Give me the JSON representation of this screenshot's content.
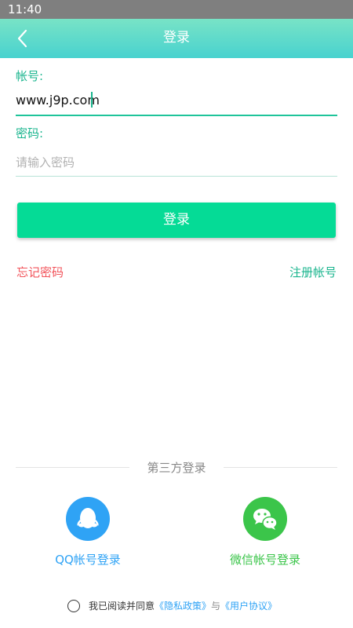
{
  "status_bar": {
    "time": "11:40"
  },
  "header": {
    "title": "登录",
    "back_icon": "chevron-left-icon"
  },
  "account": {
    "label": "帐号:",
    "value": "www.j9p.com"
  },
  "password": {
    "label": "密码:",
    "placeholder": "请输入密码",
    "value": ""
  },
  "actions": {
    "login_label": "登录",
    "forgot_label": "忘记密码",
    "register_label": "注册帐号"
  },
  "third_party": {
    "label": "第三方登录",
    "qq": {
      "label": "QQ帐号登录",
      "icon": "qq-penguin-icon"
    },
    "wechat": {
      "label": "微信帐号登录",
      "icon": "wechat-icon"
    }
  },
  "agreement": {
    "prefix": "我已阅读并同意",
    "privacy_policy": "《隐私政策》",
    "conjunction": "与",
    "user_agreement": "《用户协议》"
  },
  "colors": {
    "accent": "#1ab58e",
    "button": "#05db96",
    "link_red": "#f2545b",
    "qq_blue": "#2fa3f5",
    "wechat_green": "#3bc54a"
  }
}
